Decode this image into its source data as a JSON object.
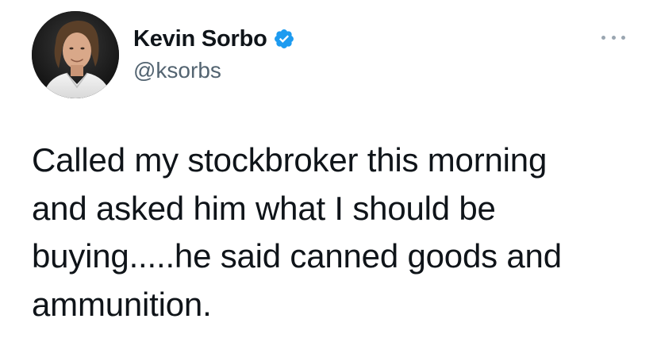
{
  "author": {
    "display_name": "Kevin Sorbo",
    "handle": "@ksorbs",
    "verified": true,
    "avatar": "profile-photo"
  },
  "tweet": {
    "lines": [
      "Called my stockbroker this morning",
      "and asked him what I should be",
      "buying.....he said canned goods and",
      "ammunition."
    ]
  },
  "icons": {
    "verified": "verified-badge-icon",
    "more": "more-options-icon"
  },
  "colors": {
    "text": "#0f1419",
    "secondary": "#536471",
    "verified_blue": "#1d9bf0",
    "background": "#ffffff"
  }
}
